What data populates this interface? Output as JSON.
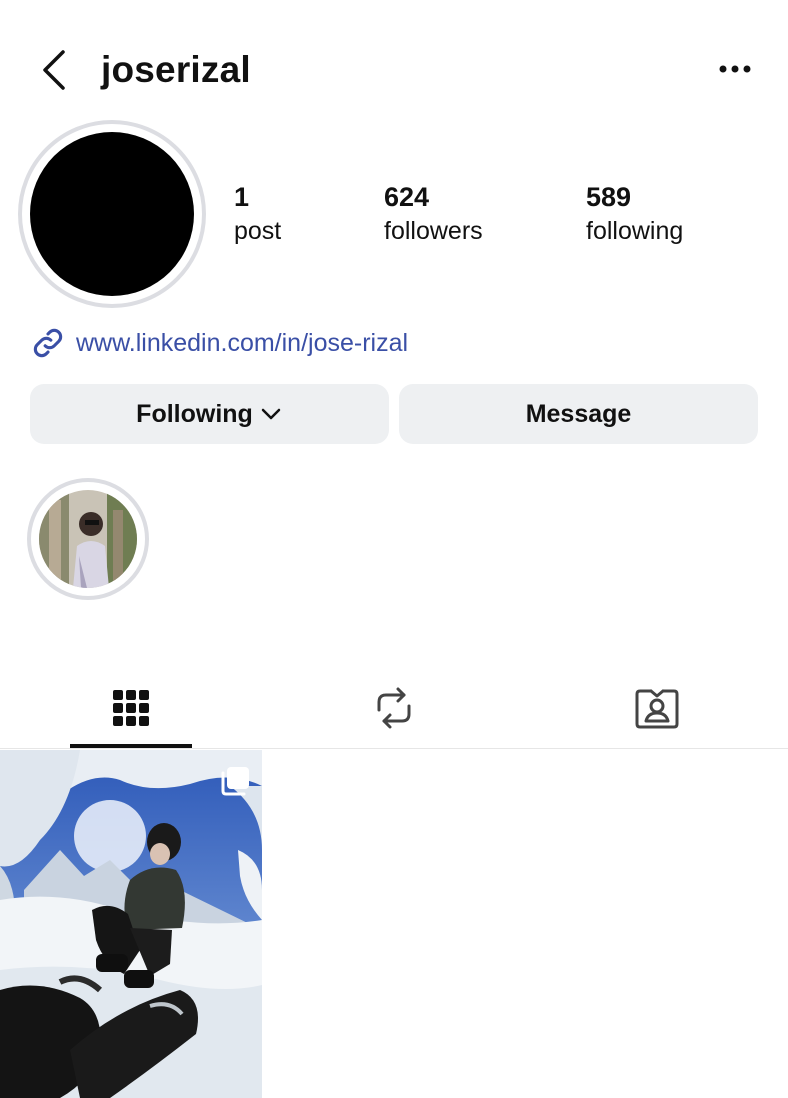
{
  "header": {
    "username": "joserizal",
    "back_icon": "chevron-left-icon",
    "more_icon": "ellipsis-icon"
  },
  "profile": {
    "stats": {
      "posts": {
        "count": "1",
        "label": "post"
      },
      "followers": {
        "count": "624",
        "label": "followers"
      },
      "following": {
        "count": "589",
        "label": "following"
      }
    },
    "link": {
      "icon": "link-icon",
      "text": "www.linkedin.com/in/jose-rizal"
    }
  },
  "actions": {
    "following_label": "Following",
    "message_label": "Message"
  },
  "tabs": [
    {
      "name": "posts-grid",
      "icon": "grid-icon",
      "active": true
    },
    {
      "name": "reposts",
      "icon": "repost-icon",
      "active": false
    },
    {
      "name": "tagged",
      "icon": "tagged-user-icon",
      "active": false
    }
  ],
  "posts": [
    {
      "type": "carousel",
      "icon": "multiple-images-icon"
    }
  ],
  "colors": {
    "link": "#3a4fa6",
    "button_bg": "#eef0f2",
    "ring": "#dcdde2",
    "text": "#111111"
  }
}
